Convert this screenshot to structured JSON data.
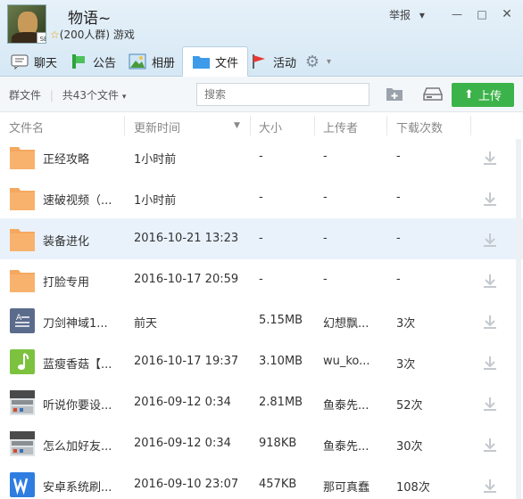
{
  "header": {
    "group_name": "物语~",
    "member_info": "(200人群) 游戏",
    "star": "☆",
    "report": "举报",
    "avatar_badge": "SE"
  },
  "tabs": [
    {
      "label": "聊天",
      "icon": "chat-icon"
    },
    {
      "label": "公告",
      "icon": "announcement-icon"
    },
    {
      "label": "相册",
      "icon": "album-icon"
    },
    {
      "label": "文件",
      "icon": "folder-icon",
      "active": true
    },
    {
      "label": "活动",
      "icon": "flag-icon"
    },
    {
      "label": "",
      "icon": "gear-icon"
    }
  ],
  "toolbar": {
    "group_files": "群文件",
    "file_count": "共43个文件",
    "search_placeholder": "搜索",
    "upload_label": "上传"
  },
  "columns": {
    "name": "文件名",
    "updated": "更新时间",
    "size": "大小",
    "uploader": "上传者",
    "downloads": "下载次数"
  },
  "rows": [
    {
      "name": "正经攻略",
      "updated": "1小时前",
      "size": "-",
      "uploader": "-",
      "downloads": "-",
      "type": "folder"
    },
    {
      "name": "速破视频（...",
      "updated": "1小时前",
      "size": "-",
      "uploader": "-",
      "downloads": "-",
      "type": "folder"
    },
    {
      "name": "装备进化",
      "updated": "2016-10-21 13:23",
      "size": "-",
      "uploader": "-",
      "downloads": "-",
      "type": "folder"
    },
    {
      "name": "打脸专用",
      "updated": "2016-10-17 20:59",
      "size": "-",
      "uploader": "-",
      "downloads": "-",
      "type": "folder"
    },
    {
      "name": "刀剑神域1...",
      "updated": "前天",
      "size": "5.15MB",
      "uploader": "幻想飘...",
      "downloads": "3次",
      "type": "doc"
    },
    {
      "name": "蓝瘦香菇【...",
      "updated": "2016-10-17 19:37",
      "size": "3.10MB",
      "uploader": "wu_ko...",
      "downloads": "3次",
      "type": "music"
    },
    {
      "name": "听说你要设...",
      "updated": "2016-09-12 0:34",
      "size": "2.81MB",
      "uploader": "鱼泰先...",
      "downloads": "52次",
      "type": "image"
    },
    {
      "name": "怎么加好友...",
      "updated": "2016-09-12 0:34",
      "size": "918KB",
      "uploader": "鱼泰先...",
      "downloads": "30次",
      "type": "image"
    },
    {
      "name": "安卓系统刷...",
      "updated": "2016-09-10 23:07",
      "size": "457KB",
      "uploader": "那可真蠢",
      "downloads": "108次",
      "type": "word"
    }
  ],
  "colors": {
    "accent": "#3cb34a",
    "folder": "#f5a860",
    "selected_row": "#e9f2fb",
    "doc_icon": "#5b6b8c",
    "music_icon": "#7cc23f",
    "word_icon": "#2f7de1"
  }
}
